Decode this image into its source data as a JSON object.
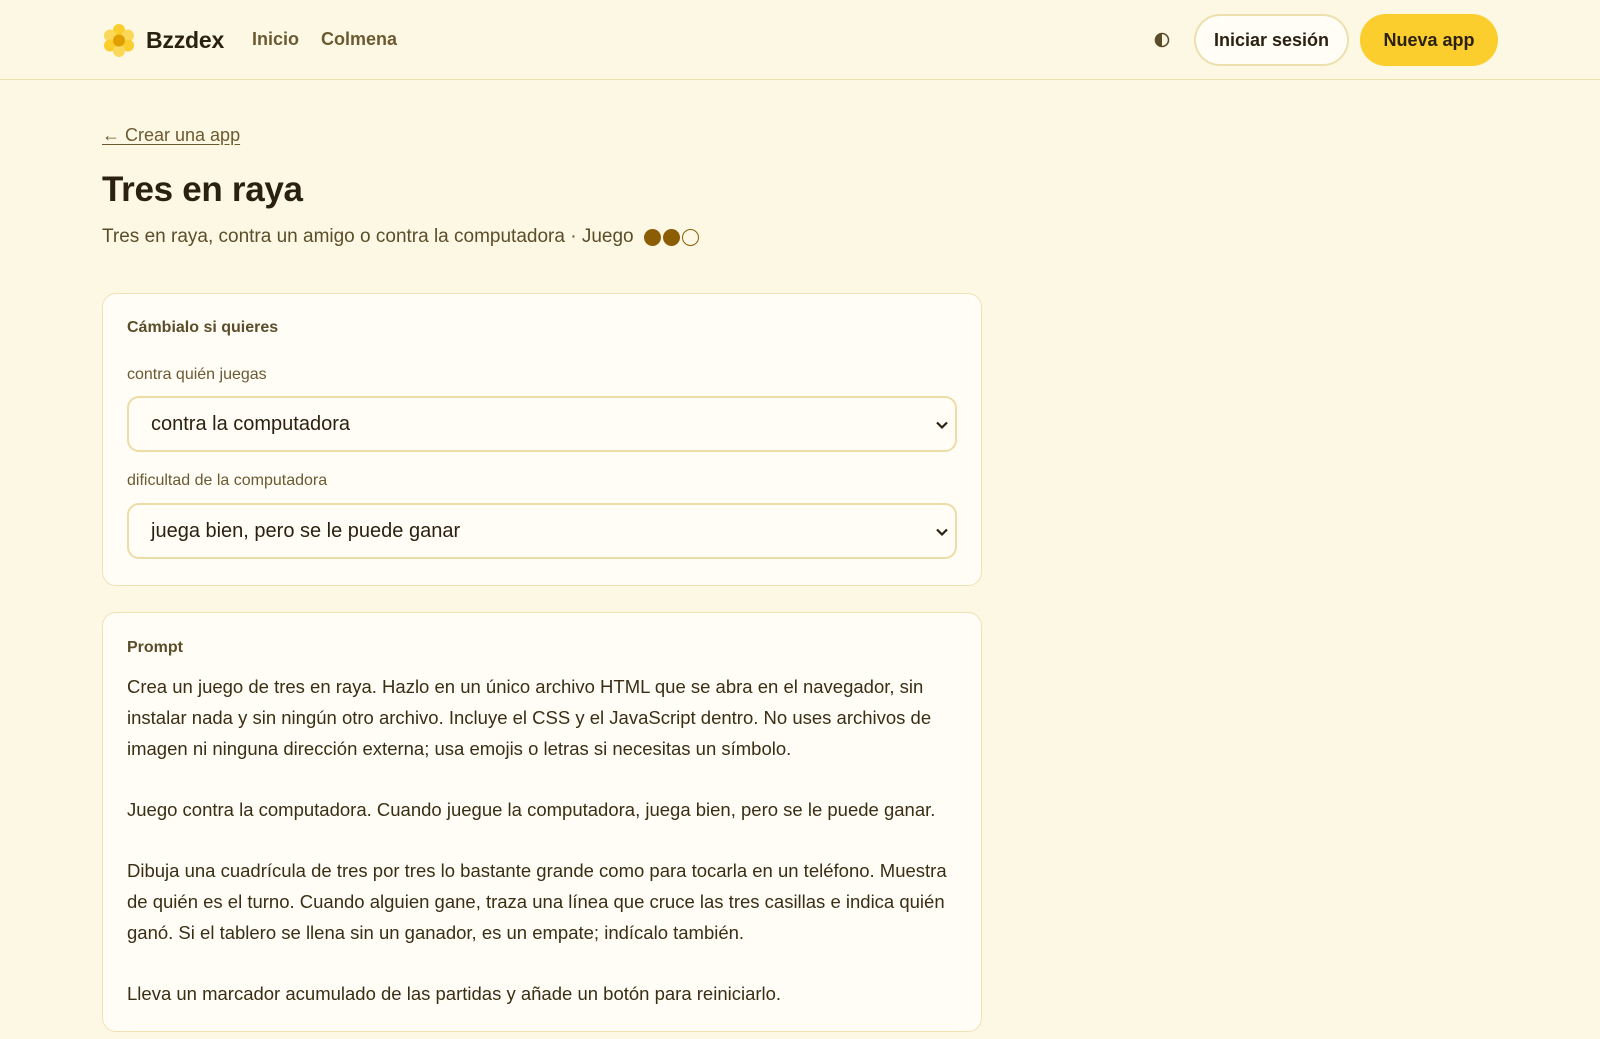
{
  "header": {
    "brand": "Bzzdex",
    "nav": [
      "Inicio",
      "Colmena"
    ],
    "theme_icon": "half-circle-icon",
    "login_label": "Iniciar sesión",
    "new_app_label": "Nueva app"
  },
  "page": {
    "back_link": "← Crear una app",
    "title": "Tres en raya",
    "subtitle": "Tres en raya, contra un amigo o contra la computadora · Juego",
    "difficulty": {
      "filled": 2,
      "total": 3
    }
  },
  "options": {
    "heading": "Cámbialo si quieres",
    "opponent_label": "contra quién juegas",
    "opponent_value": "contra la computadora",
    "difficulty_label": "dificultad de la computadora",
    "difficulty_value": "juega bien, pero se le puede ganar"
  },
  "prompt": {
    "heading": "Prompt",
    "paragraphs": [
      "Crea un juego de tres en raya. Hazlo en un único archivo HTML que se abra en el navegador, sin instalar nada y sin ningún otro archivo. Incluye el CSS y el JavaScript dentro. No uses archivos de imagen ni ninguna dirección externa; usa emojis o letras si necesitas un símbolo.",
      "Juego contra la computadora. Cuando juegue la computadora, juega bien, pero se le puede ganar.",
      "Dibuja una cuadrícula de tres por tres lo bastante grande como para tocarla en un teléfono. Muestra de quién es el turno. Cuando alguien gane, traza una línea que cruce las tres casillas e indica quién ganó. Si el tablero se llena sin un ganador, es un empate; indícalo también.",
      "Lleva un marcador acumulado de las partidas y añade un botón para reiniciarlo."
    ]
  },
  "colors": {
    "background": "#fdf8e4",
    "accent": "#fbcd2d",
    "dot": "#8b5e06"
  }
}
